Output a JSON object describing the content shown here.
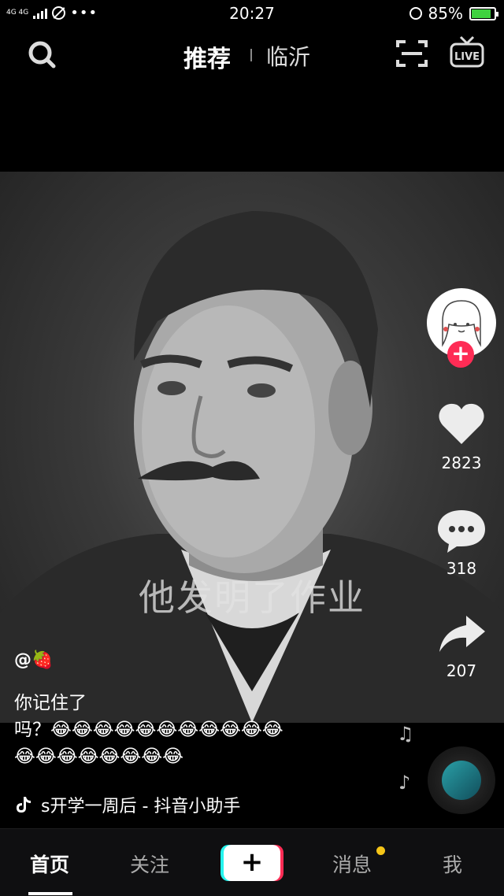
{
  "status_bar": {
    "network": "4G 4G",
    "time": "20:27",
    "battery": "85%",
    "battery_level": 0.85,
    "dots": "•••"
  },
  "top_nav": {
    "tab_recommend": "推荐",
    "tab_city": "临沂",
    "live_label": "LIVE"
  },
  "video": {
    "subtitle": "他发明了作业"
  },
  "side": {
    "follow_label": "+",
    "likes": "2823",
    "comments": "318",
    "shares": "207"
  },
  "post": {
    "username": "@🍓",
    "caption_line1": "你记住了",
    "caption_line2": "吗？😂😂😂😂😂😂😂😂😂😂😂",
    "caption_line3": "😂😂😂😂😂😂😂😂",
    "music": "s开学一周后 - 抖音小助手"
  },
  "bottom_nav": {
    "home": "首页",
    "follow": "关注",
    "add": "+",
    "messages": "消息",
    "me": "我"
  },
  "colors": {
    "accent_red": "#fe2c55",
    "accent_cyan": "#25f4ee",
    "battery_green": "#3fd23f",
    "badge_yellow": "#f5c518"
  }
}
